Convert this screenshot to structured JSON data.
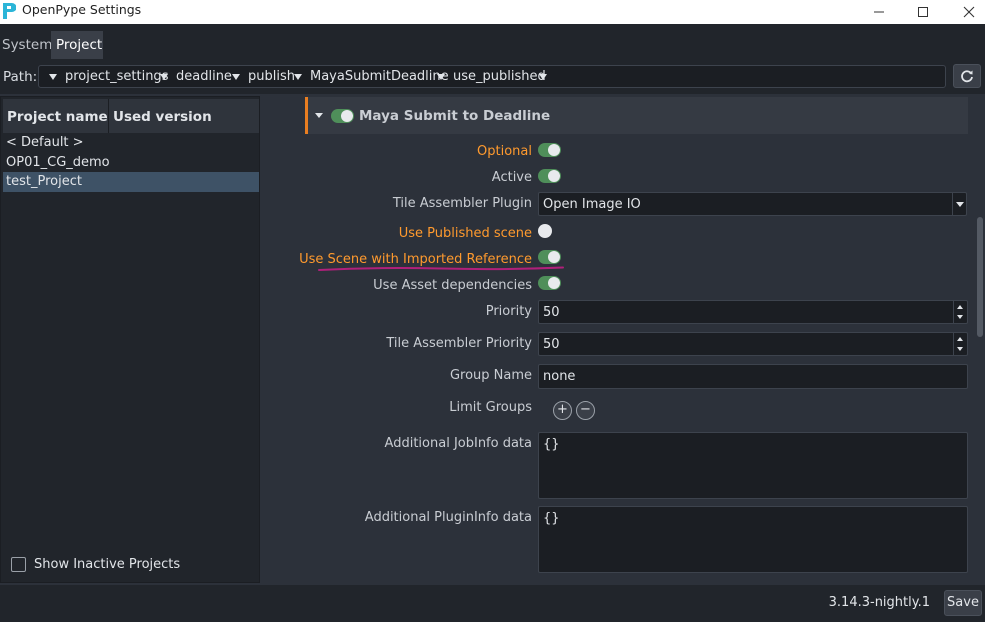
{
  "window": {
    "title": "OpenPype Settings"
  },
  "tabs": [
    {
      "label": "System"
    },
    {
      "label": "Project"
    }
  ],
  "path": {
    "label": "Path:",
    "crumbs": [
      "project_settings",
      "deadline",
      "publish",
      "MayaSubmitDeadline",
      "use_published"
    ]
  },
  "projects": {
    "columns": [
      "Project name",
      "Used version"
    ],
    "items": [
      "< Default >",
      "OP01_CG_demo",
      "test_Project"
    ],
    "selected": "test_Project",
    "show_inactive_label": "Show Inactive Projects"
  },
  "section": {
    "title": "Maya Submit to Deadline",
    "enabled": true
  },
  "settings": {
    "optional": {
      "label": "Optional",
      "value": true
    },
    "active": {
      "label": "Active",
      "value": true
    },
    "tile_plugin": {
      "label": "Tile Assembler Plugin",
      "value": "Open Image IO"
    },
    "use_published": {
      "label": "Use Published scene",
      "value": false
    },
    "use_scene_ref": {
      "label": "Use Scene with Imported Reference",
      "value": true
    },
    "use_asset_deps": {
      "label": "Use Asset dependencies",
      "value": true
    },
    "priority": {
      "label": "Priority",
      "value": "50"
    },
    "tile_priority": {
      "label": "Tile Assembler Priority",
      "value": "50"
    },
    "group_name": {
      "label": "Group Name",
      "value": "none"
    },
    "limit_groups": {
      "label": "Limit Groups",
      "add": "+",
      "remove": "−"
    },
    "jobinfo": {
      "label": "Additional JobInfo data",
      "value": "{}"
    },
    "plugininfo": {
      "label": "Additional PluginInfo data",
      "value": "{}"
    }
  },
  "footer": {
    "version": "3.14.3-nightly.1",
    "save_label": "Save"
  },
  "colors": {
    "accent_orange": "#ff9a2e",
    "toggle_on": "#4f8f5a",
    "annotation": "#b0207a"
  }
}
